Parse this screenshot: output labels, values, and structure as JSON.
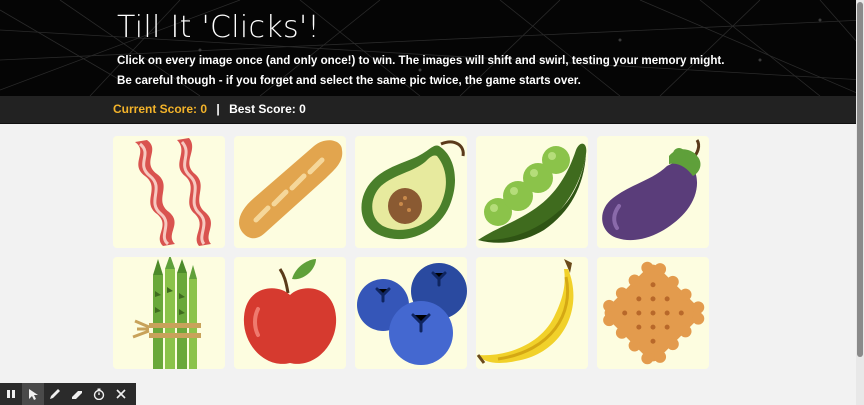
{
  "header": {
    "title": "Till It 'Clicks'!",
    "line1": "Click on every image once (and only once!) to win. The images will shift and swirl, testing your memory might.",
    "line2": "Be careful though - if you forget and select the same pic twice, the game starts over."
  },
  "score": {
    "current": "Current Score: 0",
    "separator": "|",
    "best": "Best Score: 0"
  },
  "cards": [
    {
      "icon": "bacon-icon"
    },
    {
      "icon": "baguette-icon"
    },
    {
      "icon": "avocado-icon"
    },
    {
      "icon": "peas-icon"
    },
    {
      "icon": "eggplant-icon"
    },
    {
      "icon": "asparagus-icon"
    },
    {
      "icon": "apple-icon"
    },
    {
      "icon": "blueberries-icon"
    },
    {
      "icon": "banana-icon"
    },
    {
      "icon": "cracker-icon"
    }
  ],
  "colors": {
    "header_bg": "#050505",
    "score_bar_bg": "#222222",
    "current_score": "#f3b32a",
    "card_bg": "#fdfde0"
  },
  "toolbar": [
    "pause-icon",
    "pointer-icon",
    "pen-icon",
    "eraser-icon",
    "timer-icon",
    "close-icon"
  ]
}
